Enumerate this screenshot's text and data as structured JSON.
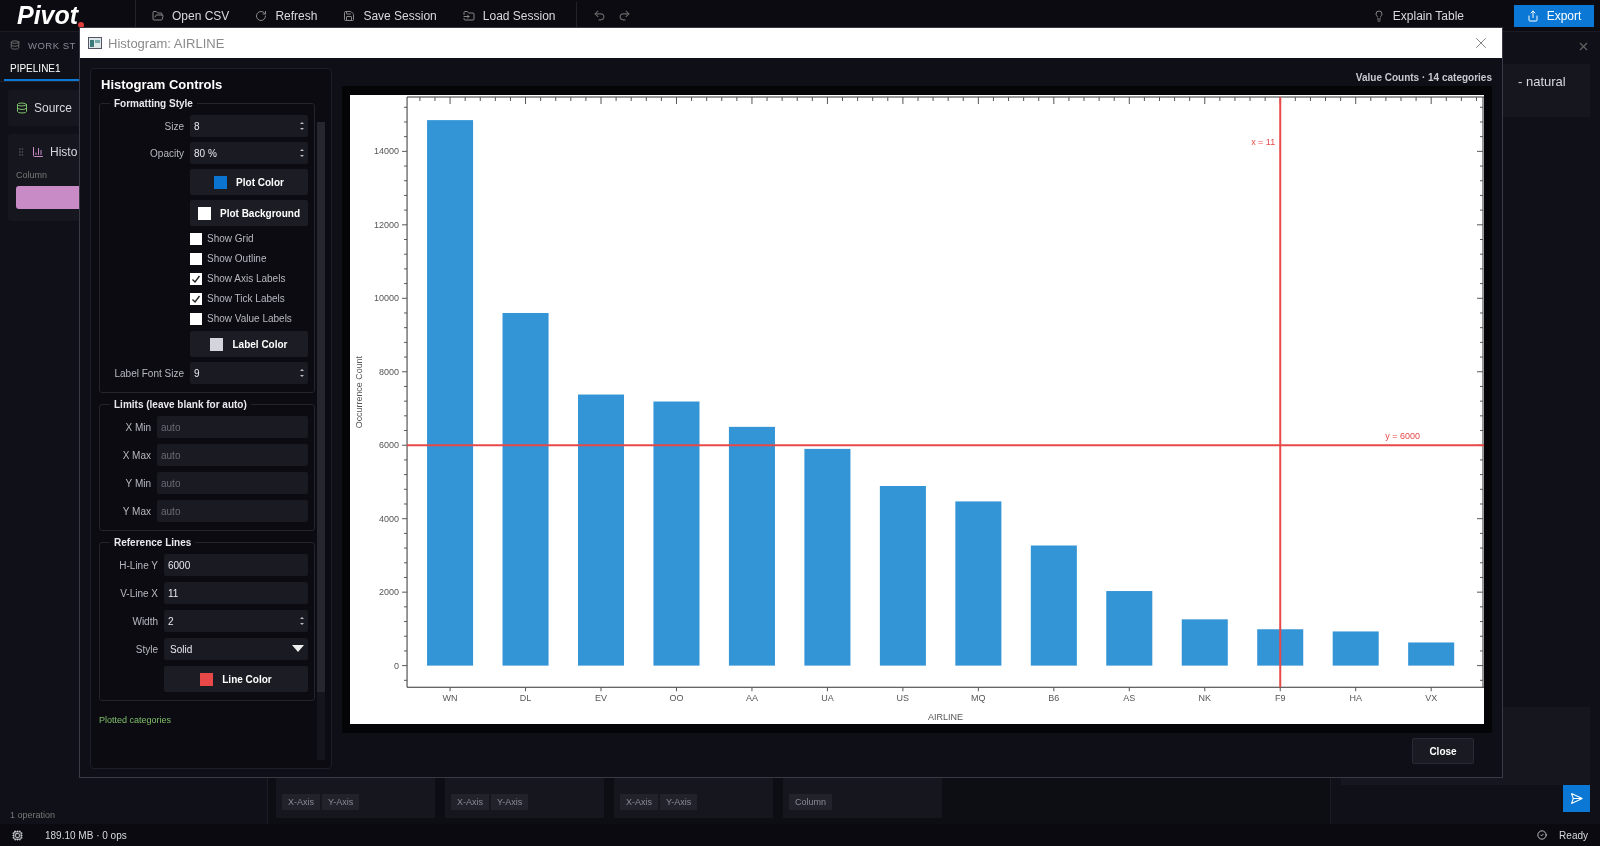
{
  "app": {
    "logo": "Pivot",
    "toolbar": [
      {
        "label": "Open CSV"
      },
      {
        "label": "Refresh"
      },
      {
        "label": "Save Session"
      },
      {
        "label": "Load Session"
      }
    ],
    "assistant_button": "Explain Table",
    "export_button": "Export"
  },
  "sidebar": {
    "header": "WORK ST",
    "tabs": [
      {
        "label": "PIPELINE1",
        "selected": true
      }
    ],
    "steps": [
      {
        "label": "Source"
      },
      {
        "label": "Histo",
        "field_label": "Column"
      }
    ],
    "footer": "1 operation"
  },
  "right_panel": {
    "snippet": "- natural"
  },
  "bottom_cards": [
    {
      "chips": [
        "X-Axis",
        "Y-Axis"
      ]
    },
    {
      "chips": [
        "X-Axis",
        "Y-Axis"
      ]
    },
    {
      "chips": [
        "X-Axis",
        "Y-Axis"
      ]
    },
    {
      "chips": [
        "Column"
      ]
    }
  ],
  "status_bar": {
    "memory": "189.10 MB · 0 ops",
    "state": "Ready"
  },
  "dialog": {
    "title": "Histogram: AIRLINE",
    "controls": {
      "title": "Histogram Controls",
      "groups": [
        {
          "title": "Formatting Style",
          "rows": [
            {
              "kind": "spin",
              "label": "Size",
              "value": "8"
            },
            {
              "kind": "spin",
              "label": "Opacity",
              "value": "80 %"
            },
            {
              "kind": "color",
              "label": "Plot Color",
              "color": "#0a74d0"
            },
            {
              "kind": "color",
              "label": "Plot Background",
              "color": "#ffffff"
            },
            {
              "kind": "check",
              "label": "Show Grid",
              "checked": false
            },
            {
              "kind": "check",
              "label": "Show Outline",
              "checked": false
            },
            {
              "kind": "check",
              "label": "Show Axis Labels",
              "checked": true
            },
            {
              "kind": "check",
              "label": "Show Tick Labels",
              "checked": true
            },
            {
              "kind": "check",
              "label": "Show Value Labels",
              "checked": false
            },
            {
              "kind": "color",
              "label": "Label Color",
              "color": "#d4d4dc"
            },
            {
              "kind": "spin",
              "label": "Label Font Size",
              "value": "9"
            }
          ]
        },
        {
          "title": "Limits (leave blank for auto)",
          "rows": [
            {
              "kind": "text",
              "label": "X Min",
              "placeholder": "auto"
            },
            {
              "kind": "text",
              "label": "X Max",
              "placeholder": "auto"
            },
            {
              "kind": "text",
              "label": "Y Min",
              "placeholder": "auto"
            },
            {
              "kind": "text",
              "label": "Y Max",
              "placeholder": "auto"
            }
          ]
        },
        {
          "title": "Reference Lines",
          "rows": [
            {
              "kind": "text",
              "label": "H-Line Y",
              "value": "6000"
            },
            {
              "kind": "text",
              "label": "V-Line X",
              "value": "11"
            },
            {
              "kind": "spin",
              "label": "Width",
              "value": "2"
            },
            {
              "kind": "select",
              "label": "Style",
              "value": "Solid"
            },
            {
              "kind": "color",
              "label": "Line Color",
              "color": "#e84848"
            }
          ]
        }
      ],
      "note": "Plotted categories"
    },
    "chart_header": "Value Counts · 14 categories",
    "chart_data": {
      "type": "bar",
      "xlabel": "AIRLINE",
      "ylabel": "Occurrence Count",
      "categories": [
        "WN",
        "DL",
        "EV",
        "OO",
        "AA",
        "UA",
        "US",
        "MQ",
        "B6",
        "AS",
        "NK",
        "F9",
        "HA",
        "VX"
      ],
      "series": [
        {
          "color": "#3394d6",
          "values": [
            14850,
            9600,
            7380,
            7190,
            6500,
            5900,
            4890,
            4470,
            3270,
            2030,
            1260,
            990,
            930,
            630
          ]
        }
      ],
      "ylim": [
        -590,
        15480
      ],
      "yticks": [
        0,
        2000,
        4000,
        {
          "value": 6000,
          "label": "6000"
        },
        8000,
        10000,
        12000,
        14000
      ],
      "ref_lines": [
        {
          "axis": "y",
          "value": 6000,
          "label": "y = 6000"
        },
        {
          "axis": "x",
          "value": "F9",
          "label": "x = 11"
        }
      ]
    },
    "close_button": "Close"
  }
}
